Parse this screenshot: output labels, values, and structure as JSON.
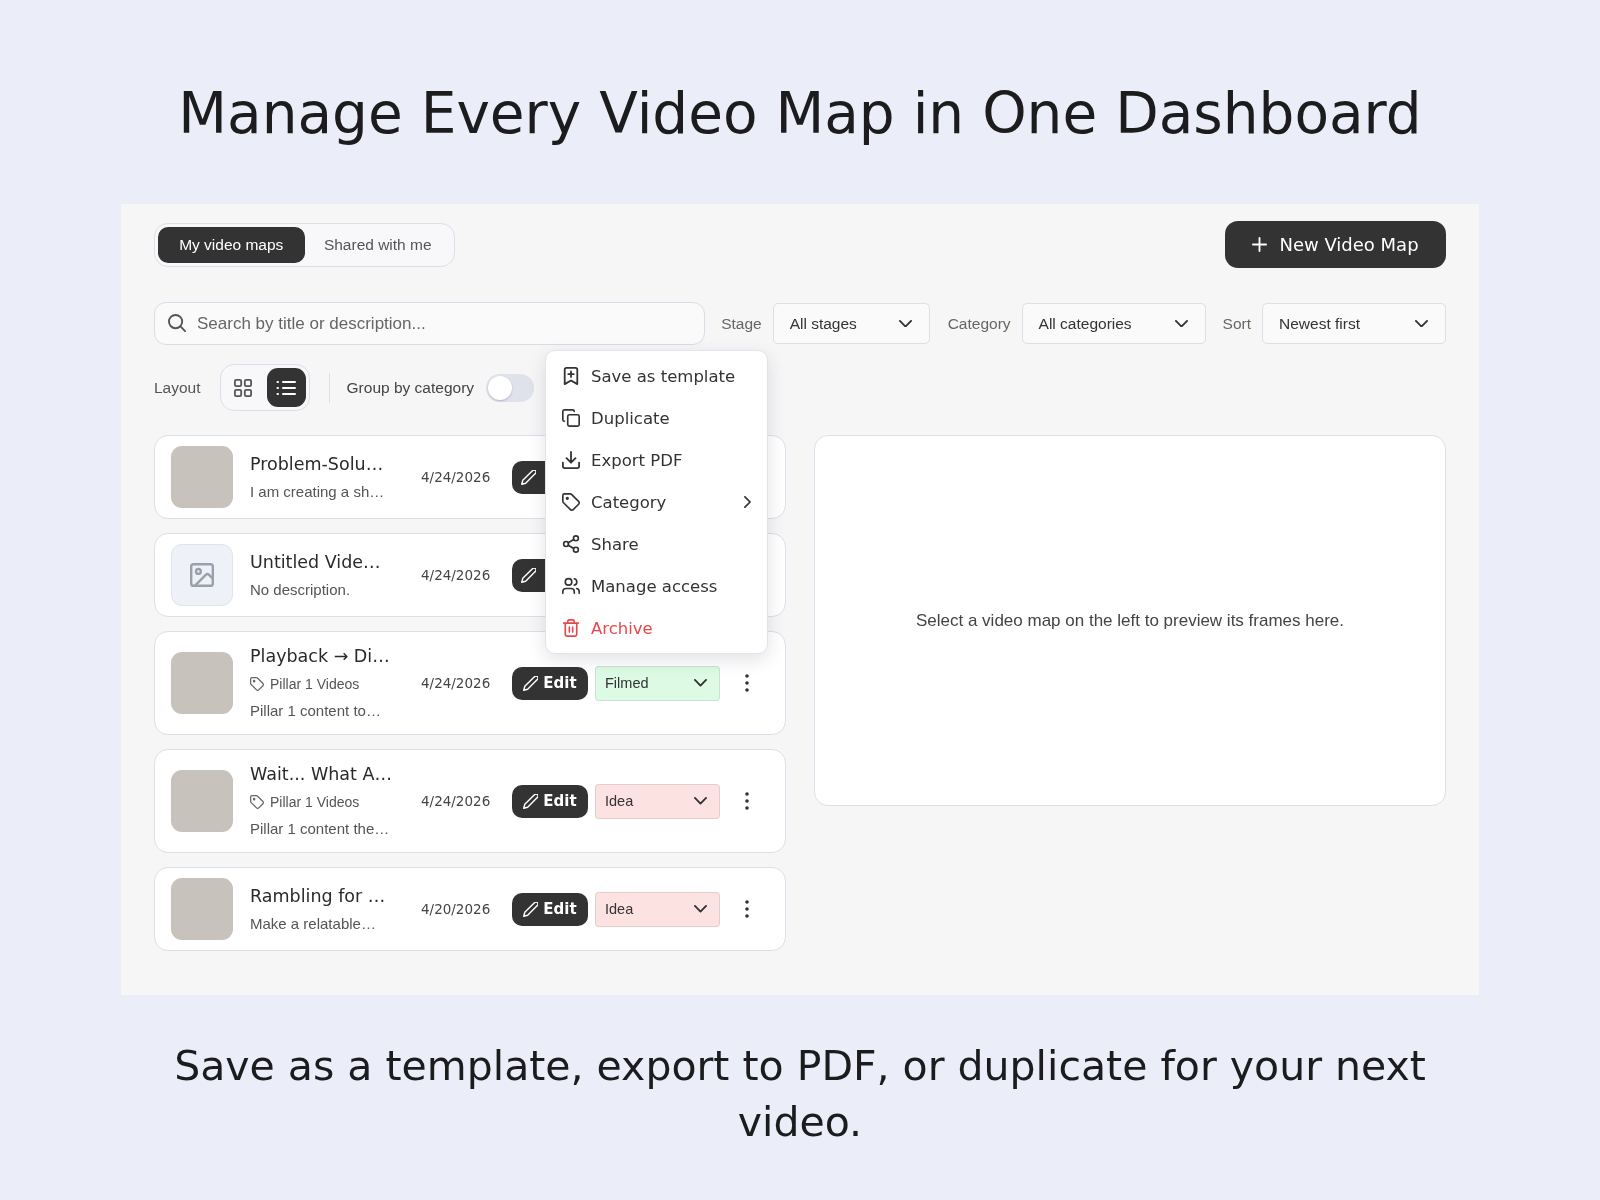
{
  "headline": "Manage Every Video Map in One Dashboard",
  "tabs": [
    {
      "label": "My video maps",
      "selected": true
    },
    {
      "label": "Shared with me",
      "selected": false
    }
  ],
  "new_button": {
    "label": "New Video Map"
  },
  "search": {
    "placeholder": "Search by title or description..."
  },
  "filters": [
    {
      "label": "Stage",
      "value": "All stages"
    },
    {
      "label": "Category",
      "value": "All categories"
    },
    {
      "label": "Sort",
      "value": "Newest first"
    }
  ],
  "layout": {
    "label": "Layout",
    "options": [
      {
        "kind": "grid",
        "selected": false
      },
      {
        "kind": "list",
        "selected": true
      }
    ]
  },
  "group_toggle": {
    "label": "Group by category",
    "on": false
  },
  "rows": [
    {
      "kind": "photo",
      "title": "Problem-Solu…",
      "description": "I am creating a sh…",
      "date": "4/24/2026"
    },
    {
      "kind": "empty",
      "title": "Untitled Vide…",
      "description": "No description.",
      "date": "4/24/2026"
    },
    {
      "kind": "photo",
      "title": "Playback → Di…",
      "tag": "Pillar 1 Videos",
      "description": "Pillar 1 content to…",
      "date": "4/24/2026",
      "edit_label": "Edit",
      "stage": {
        "label": "Filmed",
        "color": "#dcfae4"
      }
    },
    {
      "kind": "photo",
      "title": "Wait... What A…",
      "tag": "Pillar 1 Videos",
      "description": "Pillar 1 content the…",
      "date": "4/24/2026",
      "edit_label": "Edit",
      "stage": {
        "label": "Idea",
        "color": "#fde2e2"
      }
    },
    {
      "kind": "photo",
      "title": "Rambling for …",
      "description": "Make a relatable…",
      "date": "4/20/2026",
      "edit_label": "Edit",
      "stage": {
        "label": "Idea",
        "color": "#fde2e2"
      }
    }
  ],
  "menu": {
    "items": [
      {
        "kind": "template",
        "label": "Save as template",
        "submenu": false,
        "danger": false
      },
      {
        "kind": "duplicate",
        "label": "Duplicate",
        "submenu": false,
        "danger": false
      },
      {
        "kind": "export",
        "label": "Export PDF",
        "submenu": false,
        "danger": false
      },
      {
        "kind": "category",
        "label": "Category",
        "submenu": true,
        "danger": false
      },
      {
        "kind": "share",
        "label": "Share",
        "submenu": false,
        "danger": false
      },
      {
        "kind": "access",
        "label": "Manage access",
        "submenu": false,
        "danger": false
      },
      {
        "kind": "archive",
        "label": "Archive",
        "submenu": false,
        "danger": true
      }
    ]
  },
  "preview": {
    "message": "Select a video map on the left to preview its frames here."
  },
  "caption": "Save as a template, export to PDF, or duplicate for your next video."
}
